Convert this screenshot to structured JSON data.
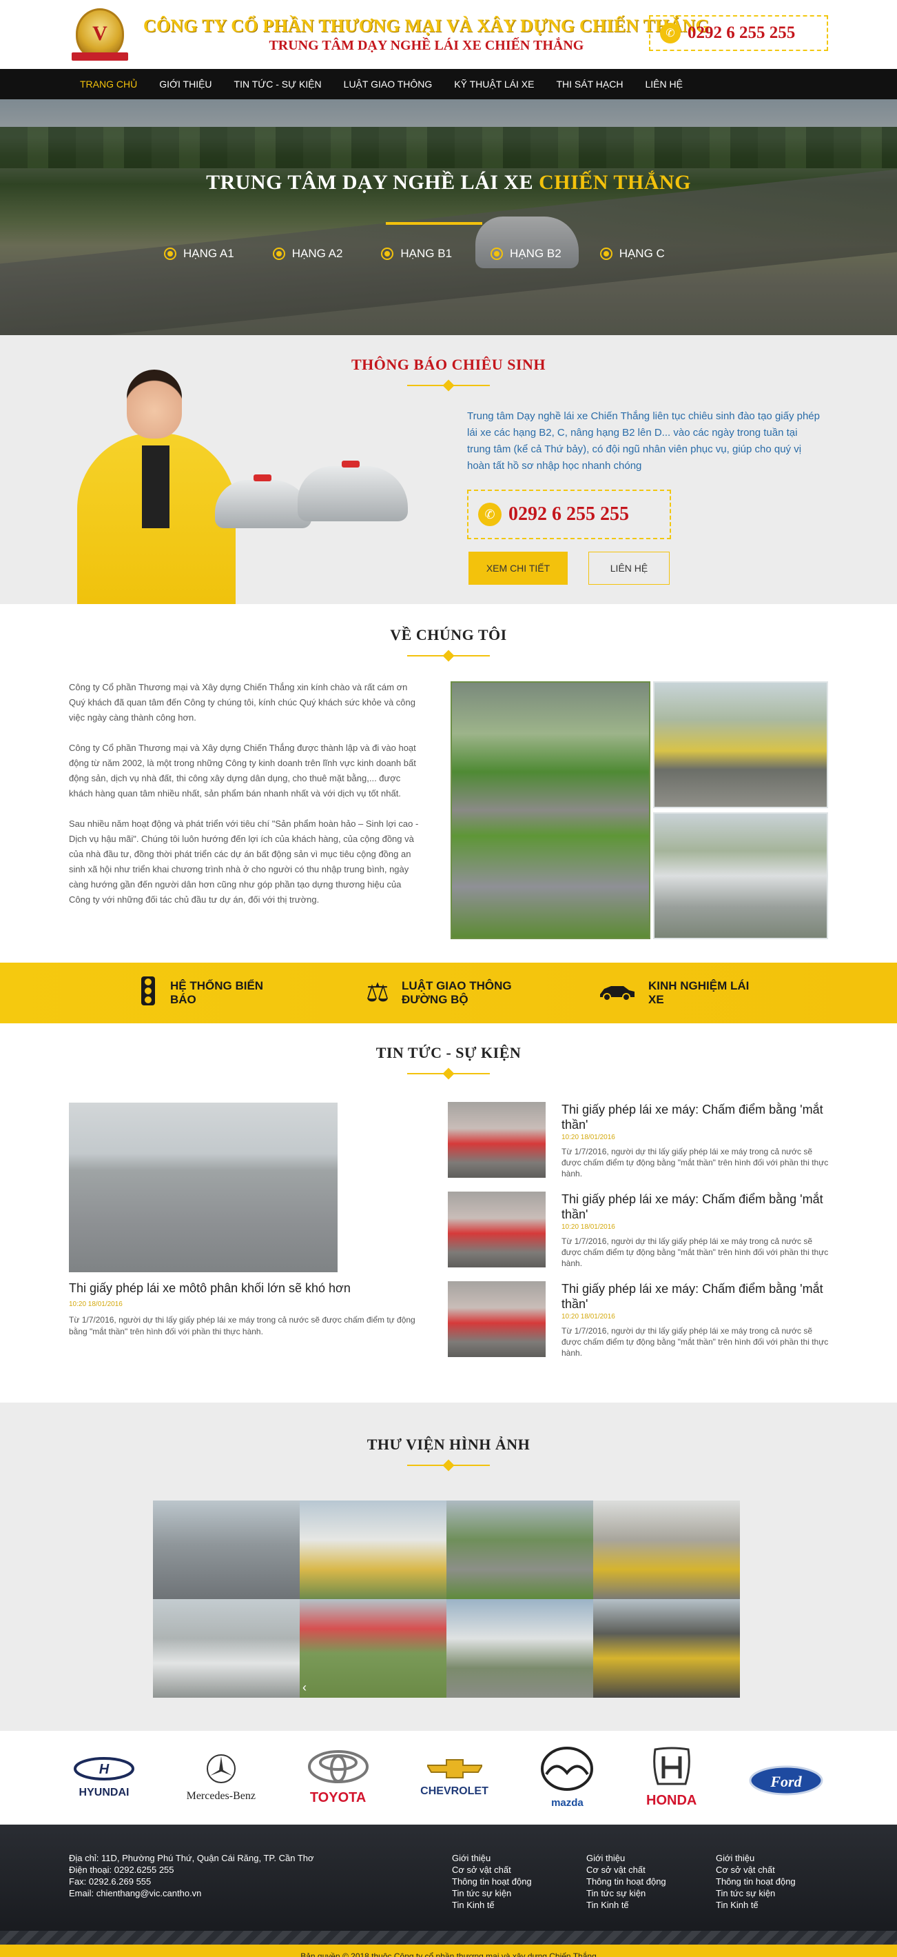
{
  "header": {
    "logo_letter": "V",
    "company": "CÔNG TY CỔ PHẦN THƯƠNG MẠI VÀ XÂY DỰNG CHIẾN THẮNG",
    "subtitle": "TRUNG TÂM DẠY NGHỀ LÁI XE CHIẾN THẮNG",
    "hotline": "0292 6 255 255"
  },
  "nav": {
    "items": [
      "TRANG CHỦ",
      "GIỚI THIỆU",
      "TIN TỨC - SỰ KIỆN",
      "LUẬT GIAO THÔNG",
      "KỸ THUẬT LÁI XE",
      "THI SÁT HẠCH",
      "LIÊN HỆ"
    ],
    "active": "TRANG CHỦ"
  },
  "hero": {
    "title_main": "TRUNG TÂM DẠY NGHỀ LÁI XE",
    "title_highlight": "CHIẾN THẮNG",
    "categories": [
      "HẠNG A1",
      "HẠNG A2",
      "HẠNG B1",
      "HẠNG B2",
      "HẠNG C"
    ]
  },
  "enroll": {
    "title": "THÔNG BÁO CHIÊU SINH",
    "text": "Trung tâm Dạy nghề lái xe Chiến Thắng liên tục chiêu sinh đào tạo giấy phép  lái xe các hạng B2, C, nâng hạng B2 lên D... vào các ngày trong tuần tại trung tâm (kể cả Thứ bảy), có đội ngũ nhân viên phục vụ, giúp cho quý vị hoàn tất hồ sơ nhập học nhanh chóng",
    "hotline": "0292 6 255 255",
    "btn_detail": "XEM CHI TIẾT",
    "btn_contact": "LIÊN HỆ"
  },
  "about": {
    "title": "VỀ CHÚNG TÔI",
    "p1": "Công ty Cổ phần Thương mại và Xây dựng Chiến Thắng xin kính chào và rất cám ơn Quý khách đã quan tâm đến Công ty chúng tôi, kính chúc Quý khách sức khỏe và công việc ngày càng thành công hơn.",
    "p2": "Công ty Cổ phần Thương mại và Xây dựng Chiến Thắng được thành lập và đi vào hoạt động từ năm 2002, là một trong những Công ty kinh doanh trên lĩnh vực kinh doanh bất động sản, dịch vụ nhà đất, thi công xây dựng dân dụng, cho thuê mặt bằng,... được khách hàng quan tâm nhiều nhất, sản phẩm bán nhanh nhất và với dịch vụ tốt nhất.",
    "p3": "Sau nhiều năm hoạt động và phát triển với tiêu chí \"Sản phẩm hoàn hảo – Sinh lợi cao - Dịch vụ hậu mãi\". Chúng tôi luôn hướng đến lợi ích của khách hàng, của cộng đồng và của nhà đầu tư, đồng thời phát triển các dự án bất động sản vì mục tiêu cộng đồng an sinh xã hội như triển khai chương trình nhà ở cho người có thu nhập trung bình, ngày càng hướng gần đến người dân hơn cũng như góp phần tạo dựng thương hiệu của Công ty với những đối tác chủ đầu tư dự án, đối với thị trường."
  },
  "features": [
    {
      "icon": "traffic-light-icon",
      "label": "HỆ THỐNG BIỂN BÁO"
    },
    {
      "icon": "scales-icon",
      "label": "LUẬT GIAO THÔNG ĐƯỜNG BỘ"
    },
    {
      "icon": "car-icon",
      "label": "KINH NGHIỆM LÁI XE"
    }
  ],
  "news": {
    "title": "TIN TỨC - SỰ KIỆN",
    "main": {
      "title": "Thi giấy phép lái xe môtô phân khối lớn sẽ khó hơn",
      "date": "10:20 18/01/2016",
      "summary": "Từ 1/7/2016, người dự thi lấy giấy phép lái xe máy trong cả nước sẽ được chấm điểm tự động bằng \"mắt thần\" trên hình đối với phần thi thực hành."
    },
    "items": [
      {
        "title": "Thi giấy phép lái xe máy: Chấm điểm bằng 'mắt thần'",
        "date": "10:20 18/01/2016",
        "summary": "Từ 1/7/2016, người dự thi lấy giấy phép lái xe máy trong cả nước sẽ được chấm điểm tự động bằng \"mắt thần\" trên hình đối với phần thi thực hành."
      },
      {
        "title": "Thi giấy phép lái xe máy: Chấm điểm bằng 'mắt thần'",
        "date": "10:20 18/01/2016",
        "summary": "Từ 1/7/2016, người dự thi lấy giấy phép lái xe máy trong cả nước sẽ được chấm điểm tự động bằng \"mắt thần\" trên hình đối với phần thi thực hành."
      },
      {
        "title": "Thi giấy phép lái xe máy: Chấm điểm bằng 'mắt thần'",
        "date": "10:20 18/01/2016",
        "summary": "Từ 1/7/2016, người dự thi lấy giấy phép lái xe máy trong cả nước sẽ được chấm điểm tự động bằng \"mắt thần\" trên hình đối với phần thi thực hành."
      }
    ]
  },
  "gallery": {
    "title": "THƯ VIỆN HÌNH ẢNH",
    "prev_arrow": "‹"
  },
  "brands": [
    "HYUNDAI",
    "Mercedes-Benz",
    "TOYOTA",
    "CHEVROLET",
    "mazda",
    "HONDA",
    "Ford"
  ],
  "footer": {
    "address": "Địa chỉ: 11D, Phường Phú Thứ, Quận Cái Răng, TP. Cần Thơ",
    "phone": "Điện thoại: 0292.6255 255",
    "fax": "Fax: 0292.6.269 555",
    "email": "Email: chienthang@vic.cantho.vn",
    "col1": [
      "Giới thiệu",
      "Cơ sở vật chất",
      "Thông tin hoạt động",
      "Tin tức sự kiện",
      "Tin Kinh tế"
    ],
    "col2": [
      "Giới thiệu",
      "Cơ sở vật chất",
      "Thông tin hoạt động",
      "Tin tức sự kiện",
      "Tin Kinh tế"
    ],
    "col3": [
      "Giới thiệu",
      "Cơ sở vật chất",
      "Thông tin hoạt động",
      "Tin tức sự kiện",
      "Tin Kinh tế"
    ],
    "copyright": "Bản quyền © 2018 thuộc Công ty cổ phần thương mại và xây dựng Chiến Thắng"
  },
  "colors": {
    "accent": "#f3c20c",
    "brand_red": "#c4161c",
    "link_blue": "#2a6ca8",
    "nav_bg": "#111111"
  }
}
